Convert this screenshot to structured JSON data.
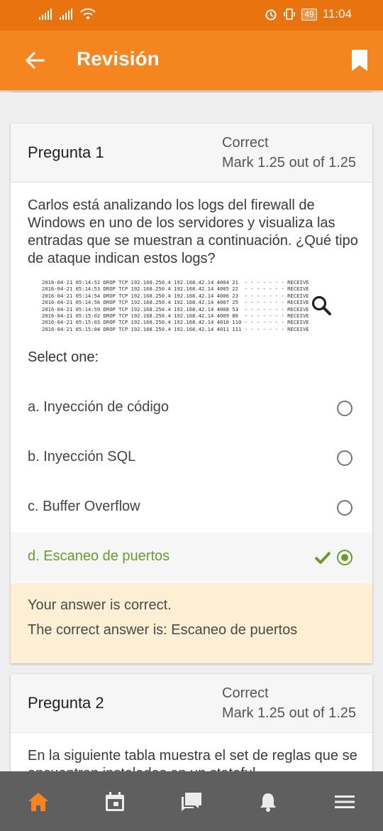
{
  "status_bar": {
    "time": "11:04",
    "battery": "49",
    "icons": [
      "signal-icon",
      "signal-icon",
      "wifi-icon",
      "alarm-icon",
      "vibrate-icon",
      "battery-icon"
    ]
  },
  "app_bar": {
    "title": "Revisión",
    "back_icon": "back-arrow-icon",
    "bookmark_icon": "bookmark-icon"
  },
  "questions": [
    {
      "title": "Pregunta 1",
      "state": "Correct",
      "mark": "Mark 1.25 out of 1.25",
      "text": "Carlos está analizando los logs del firewall de Windows en uno de los servidores y visualiza las entradas que se muestran a continuación. ¿Qué tipo de ataque indican estos logs?",
      "log_lines": [
        "2016-04-21 05:14:52 DROP TCP 192.168.250.4 192.168.42.14 4004 21  - - - - - - - RECEIVE",
        "2016-04-21 05:14:53 DROP TCP 192.168.250.4 192.168.42.14 4005 22  - - - - - - - RECEIVE",
        "2016-04-21 05:14:54 DROP TCP 192.168.250.4 192.168.42.14 4006 23  - - - - - - - RECEIVE",
        "2016-04-21 05:14:56 DROP TCP 192.168.250.4 192.168.42.14 4007 25  - - - - - - - RECEIVE",
        "2016-04-21 05:14:59 DROP TCP 192.168.250.4 192.168.42.14 4008 53  - - - - - - - RECEIVE",
        "2016-04-21 05:15:02 DROP TCP 192.168.250.4 192.168.42.14 4009 80  - - - - - - - RECEIVE",
        "2016-04-21 05:15:03 DROP TCP 192.168.250.4 192.168.42.14 4010 110 - - - - - - - RECEIVE",
        "2016-04-21 05:15:04 DROP TCP 192.168.250.4 192.168.42.14 4011 111 - - - - - - - RECEIVE"
      ],
      "select_label": "Select one:",
      "options": [
        {
          "label": "a. Inyección de código",
          "selected": false
        },
        {
          "label": "b. Inyección SQL",
          "selected": false
        },
        {
          "label": "c. Buffer Overflow",
          "selected": false
        },
        {
          "label": "d. Escaneo de puertos",
          "selected": true,
          "correct": true
        }
      ],
      "feedback": {
        "line1": "Your answer is correct.",
        "line2": "The correct answer is: Escaneo de puertos"
      }
    },
    {
      "title": "Pregunta 2",
      "state": "Correct",
      "mark": "Mark 1.25 out of 1.25",
      "text": "En la siguiente tabla muestra el set de reglas que se encuentran instaladas en un stateful"
    }
  ],
  "bottom_nav": [
    {
      "icon": "home-icon",
      "active": true
    },
    {
      "icon": "calendar-icon",
      "active": false
    },
    {
      "icon": "messages-icon",
      "active": false
    },
    {
      "icon": "notifications-icon",
      "active": false
    },
    {
      "icon": "menu-icon",
      "active": false
    }
  ],
  "colors": {
    "status_bar": "#e8730f",
    "app_bar": "#f5851f",
    "correct_green": "#6d9a2b",
    "feedback_bg": "#fcefd3",
    "bottom_nav": "#5f5f5f",
    "active_nav": "#f5851f"
  }
}
